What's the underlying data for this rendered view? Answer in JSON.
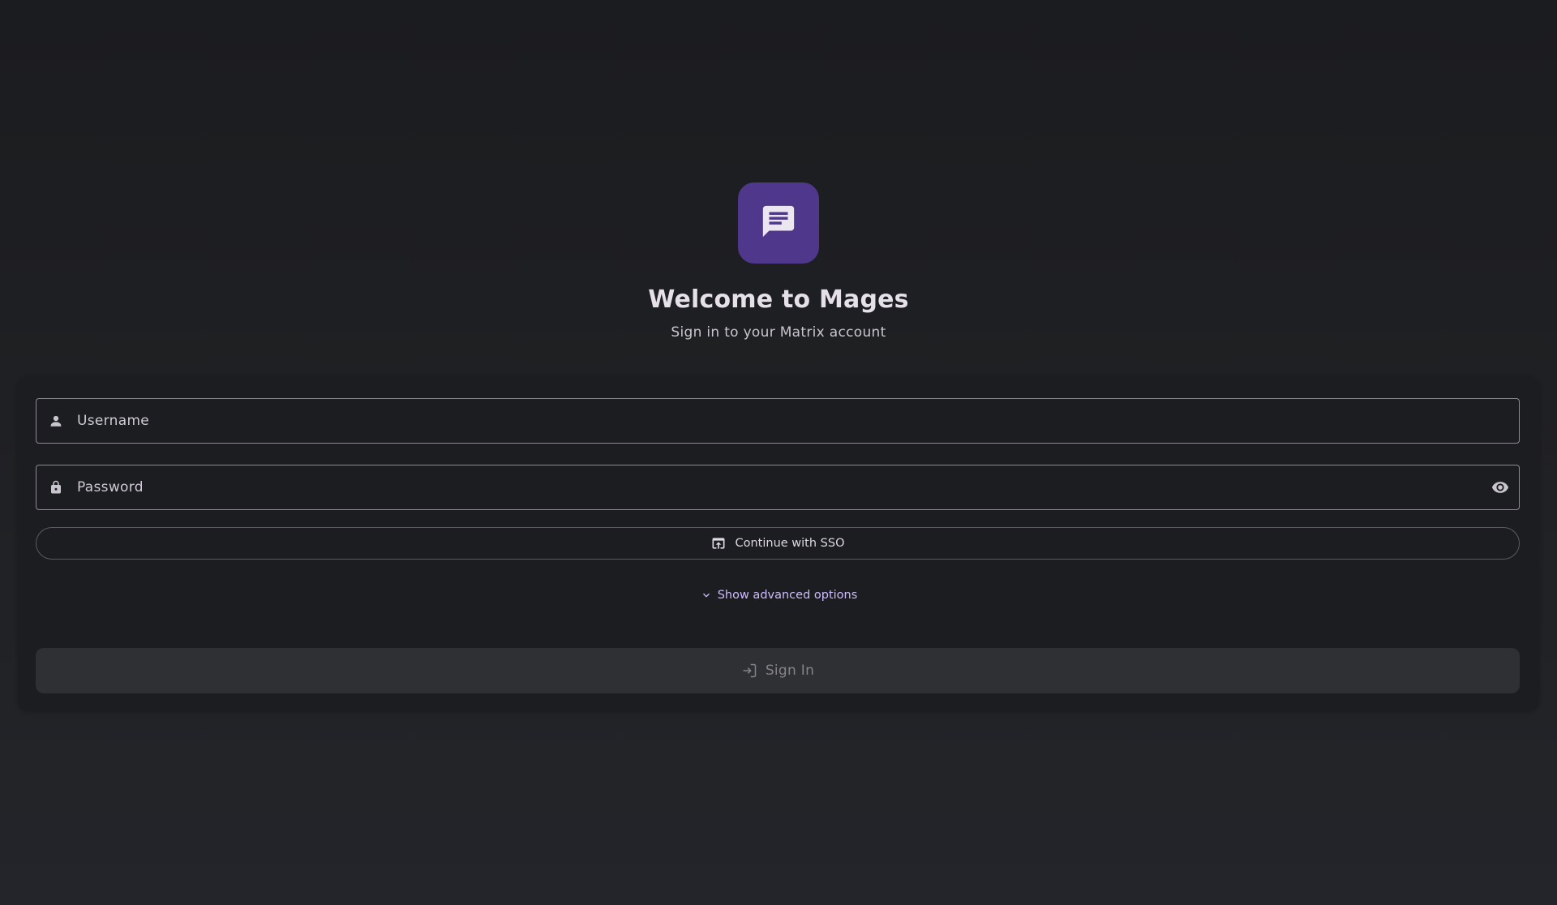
{
  "app": {
    "icon": "chat-bubble-icon",
    "accent_color": "#4f378b",
    "link_color": "#cfbcff"
  },
  "header": {
    "title": "Welcome to Mages",
    "subtitle": "Sign in to your Matrix account"
  },
  "form": {
    "username": {
      "placeholder": "Username",
      "value": "",
      "icon": "person-icon"
    },
    "password": {
      "placeholder": "Password",
      "value": "",
      "icon": "lock-icon",
      "toggle_icon": "eye-icon"
    },
    "sso_button": {
      "label": "Continue with SSO",
      "icon": "open-in-browser-icon"
    },
    "advanced_toggle": {
      "label": "Show advanced options",
      "icon": "chevron-down-icon"
    },
    "submit_button": {
      "label": "Sign In",
      "icon": "login-icon",
      "state": "disabled"
    }
  }
}
